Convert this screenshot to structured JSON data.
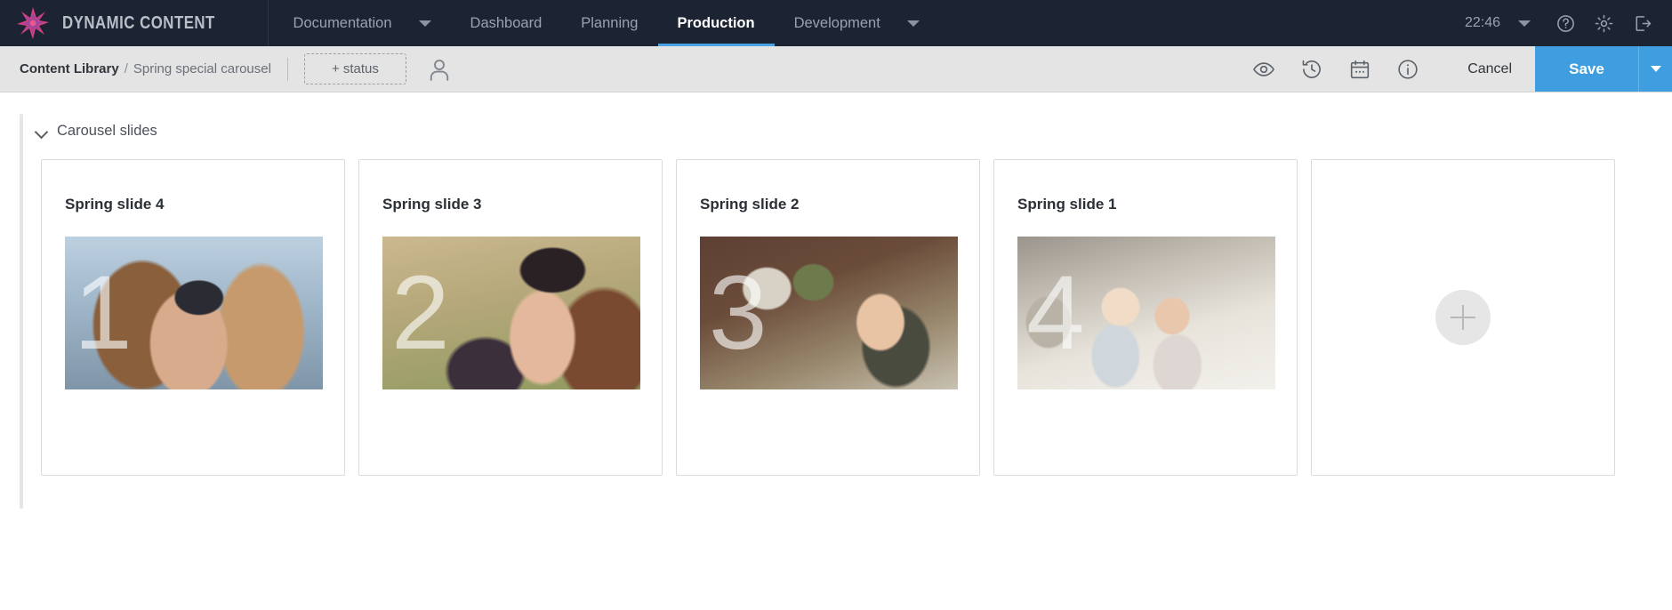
{
  "topnav": {
    "brand": "DYNAMIC CONTENT",
    "brand_logo_icon": "starburst-logo-icon",
    "items": [
      {
        "label": "Documentation",
        "active": false,
        "has_caret": true
      },
      {
        "label": "Dashboard",
        "active": false,
        "has_caret": false
      },
      {
        "label": "Planning",
        "active": false,
        "has_caret": false
      },
      {
        "label": "Production",
        "active": true,
        "has_caret": false
      },
      {
        "label": "Development",
        "active": false,
        "has_caret": true
      }
    ],
    "clock": "22:46",
    "clock_caret_icon": "chevron-down-icon",
    "help_icon": "help-circle-icon",
    "settings_icon": "gear-icon",
    "logout_icon": "logout-icon",
    "accent_active": "#49a3e3",
    "background": "#1c2433"
  },
  "toolbar": {
    "breadcrumb_root": "Content Library",
    "breadcrumb_separator": "/",
    "breadcrumb_leaf": "Spring special carousel",
    "status_label": "+ status",
    "avatar_icon": "user-avatar-icon",
    "preview_icon": "eye-icon",
    "history_icon": "history-clock-icon",
    "schedule_icon": "calendar-icon",
    "info_icon": "info-circle-icon",
    "cancel_label": "Cancel",
    "save_label": "Save",
    "save_caret_icon": "chevron-down-icon",
    "save_color": "#3e9ee0",
    "background": "#e4e4e4"
  },
  "section": {
    "collapse_icon": "chevron-down-icon",
    "title": "Carousel slides"
  },
  "slides": [
    {
      "title": "Spring slide 4",
      "overlay_number": "1",
      "photo_class": "ph-4"
    },
    {
      "title": "Spring slide 3",
      "overlay_number": "2",
      "photo_class": "ph-3"
    },
    {
      "title": "Spring slide 2",
      "overlay_number": "3",
      "photo_class": "ph-2"
    },
    {
      "title": "Spring slide 1",
      "overlay_number": "4",
      "photo_class": "ph-1"
    }
  ],
  "add_card": {
    "add_icon": "plus-circle-icon"
  }
}
